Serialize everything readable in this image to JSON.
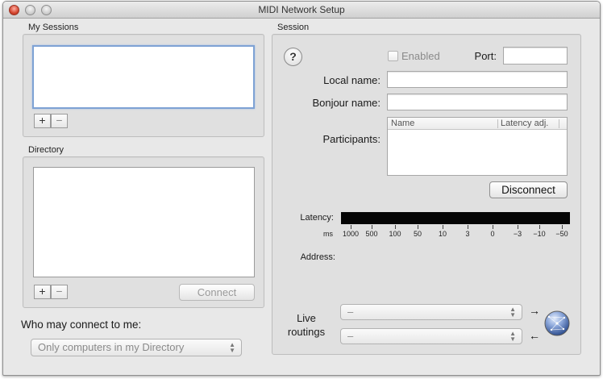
{
  "window": {
    "title": "MIDI Network Setup"
  },
  "my_sessions": {
    "label": "My Sessions",
    "add_label": "+",
    "remove_label": "−"
  },
  "directory": {
    "label": "Directory",
    "add_label": "+",
    "remove_label": "−",
    "connect_label": "Connect"
  },
  "who_may_connect": {
    "label": "Who may connect to me:",
    "selected": "Only computers in my Directory"
  },
  "session": {
    "label": "Session",
    "help_label": "?",
    "enabled_label": "Enabled",
    "port_label": "Port:",
    "port_value": "",
    "local_name_label": "Local name:",
    "local_name_value": "",
    "bonjour_name_label": "Bonjour name:",
    "bonjour_name_value": "",
    "participants_label": "Participants:",
    "participants_columns": [
      "Name",
      "Latency adj."
    ],
    "disconnect_label": "Disconnect",
    "latency_label": "Latency:",
    "latency_unit": "ms",
    "latency_ticks": [
      "1000",
      "500",
      "100",
      "50",
      "10",
      "3",
      "0",
      "−3",
      "−10",
      "−50"
    ],
    "address_label": "Address:",
    "live_routings_label_1": "Live",
    "live_routings_label_2": "routings",
    "routing_in_selected": "–",
    "routing_out_selected": "–",
    "arrow_right": "→",
    "arrow_left": "←"
  },
  "icons": {
    "close": "close-icon",
    "minimize": "minimize-icon",
    "zoom": "zoom-icon",
    "network_globe": "network-globe-icon"
  },
  "colors": {
    "focus_ring": "#7ea2d4",
    "close_button": "#d3452f",
    "latency_bar": "#050505",
    "globe": "#4d6fb0"
  }
}
